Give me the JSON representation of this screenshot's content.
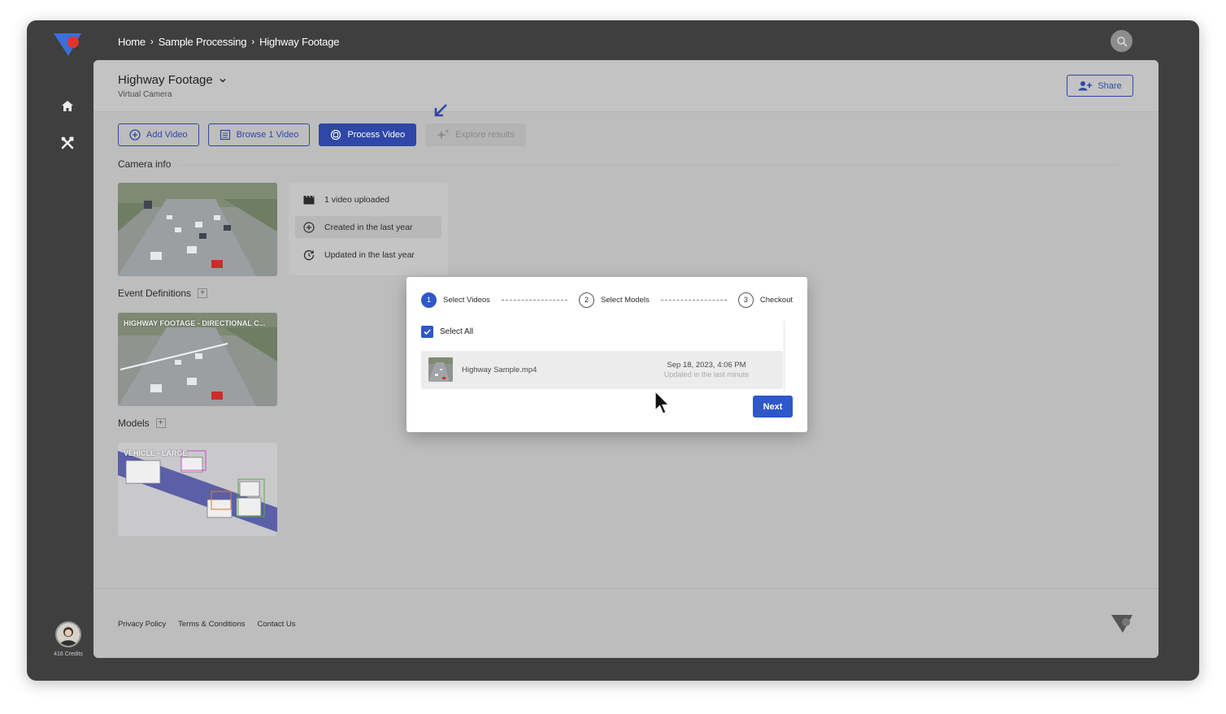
{
  "breadcrumb": [
    "Home",
    "Sample Processing",
    "Highway Footage"
  ],
  "camera": {
    "title": "Highway Footage",
    "subtitle": "Virtual Camera"
  },
  "share_label": "Share",
  "toolbar": {
    "add_video": "Add Video",
    "browse_video": "Browse 1 Video",
    "process_video": "Process Video",
    "explore_results": "Explore results"
  },
  "sections": {
    "camera_info": "Camera info",
    "event_definitions": "Event Definitions",
    "models": "Models"
  },
  "camera_info": {
    "uploaded": "1 video uploaded",
    "created": "Created in the last year",
    "updated": "Updated in the last year"
  },
  "event_definition": {
    "label": "HIGHWAY FOOTAGE - DIRECTIONAL C..."
  },
  "model": {
    "label": "VEHICLE - LARGE"
  },
  "footer": {
    "privacy": "Privacy Policy",
    "terms": "Terms & Conditions",
    "contact": "Contact Us"
  },
  "user": {
    "credits": "416 Credits"
  },
  "modal": {
    "steps": [
      {
        "num": "1",
        "label": "Select Videos",
        "active": true
      },
      {
        "num": "2",
        "label": "Select Models",
        "active": false
      },
      {
        "num": "3",
        "label": "Checkout",
        "active": false
      }
    ],
    "select_all": "Select All",
    "select_all_checked": true,
    "video": {
      "name": "Highway Sample.mp4",
      "date": "Sep 18, 2023, 4:06 PM",
      "updated": "Updated in the last minute"
    },
    "next_label": "Next"
  },
  "icons": {
    "rail": [
      "home-icon",
      "tools-icon"
    ],
    "search": "search-icon",
    "share": "add-user-icon"
  },
  "colors": {
    "accent": "#2e47a8",
    "modal_accent": "#2e57c8",
    "logo_red": "#e0342f",
    "logo_blue": "#3b6fd8"
  }
}
